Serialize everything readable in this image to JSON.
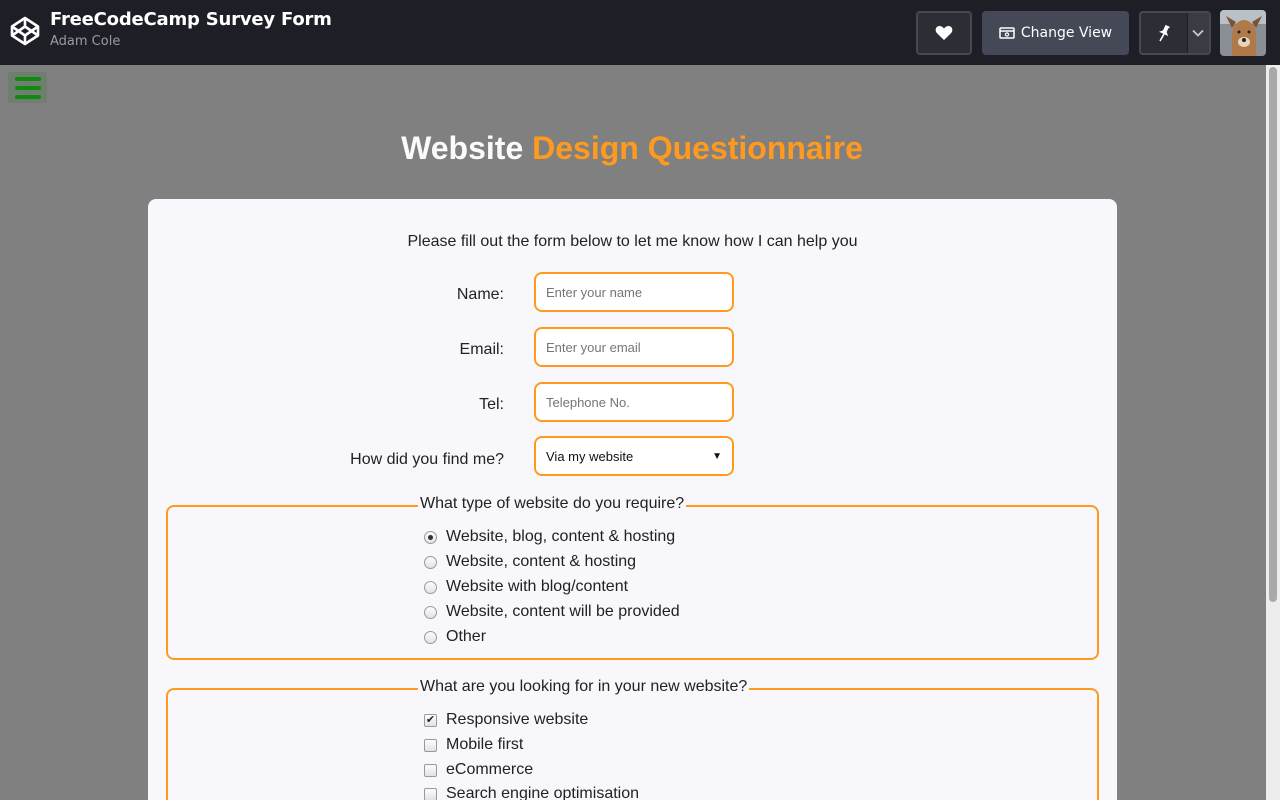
{
  "header": {
    "title": "FreeCodeCamp Survey Form",
    "author": "Adam Cole",
    "change_view_label": "Change View"
  },
  "page": {
    "title_white": "Website",
    "title_orange": "Design Questionnaire",
    "intro": "Please fill out the form below to let me know how I can help you"
  },
  "form": {
    "name_label": "Name:",
    "name_placeholder": "Enter your name",
    "email_label": "Email:",
    "email_placeholder": "Enter your email",
    "tel_label": "Tel:",
    "tel_placeholder": "Telephone No.",
    "find_label": "How did you find me?",
    "find_selected": "Via my website"
  },
  "website_type": {
    "legend": "What type of website do you require?",
    "options": [
      {
        "label": "Website, blog, content & hosting",
        "checked": true
      },
      {
        "label": "Website, content & hosting",
        "checked": false
      },
      {
        "label": "Website with blog/content",
        "checked": false
      },
      {
        "label": "Website, content will be provided",
        "checked": false
      },
      {
        "label": "Other",
        "checked": false
      }
    ]
  },
  "features": {
    "legend": "What are you looking for in your new website?",
    "options": [
      {
        "label": "Responsive website",
        "checked": true
      },
      {
        "label": "Mobile first",
        "checked": false
      },
      {
        "label": "eCommerce",
        "checked": false
      },
      {
        "label": "Search engine optimisation",
        "checked": false
      }
    ]
  },
  "colors": {
    "accent": "#ff9a1f",
    "header_bg": "#1e1f26",
    "page_bg": "#808080",
    "hamburger": "#0f8b0f"
  },
  "icons": [
    "codepen-logo-icon",
    "heart-icon",
    "change-view-icon",
    "pin-icon",
    "chevron-down-icon",
    "hamburger-menu-icon"
  ]
}
